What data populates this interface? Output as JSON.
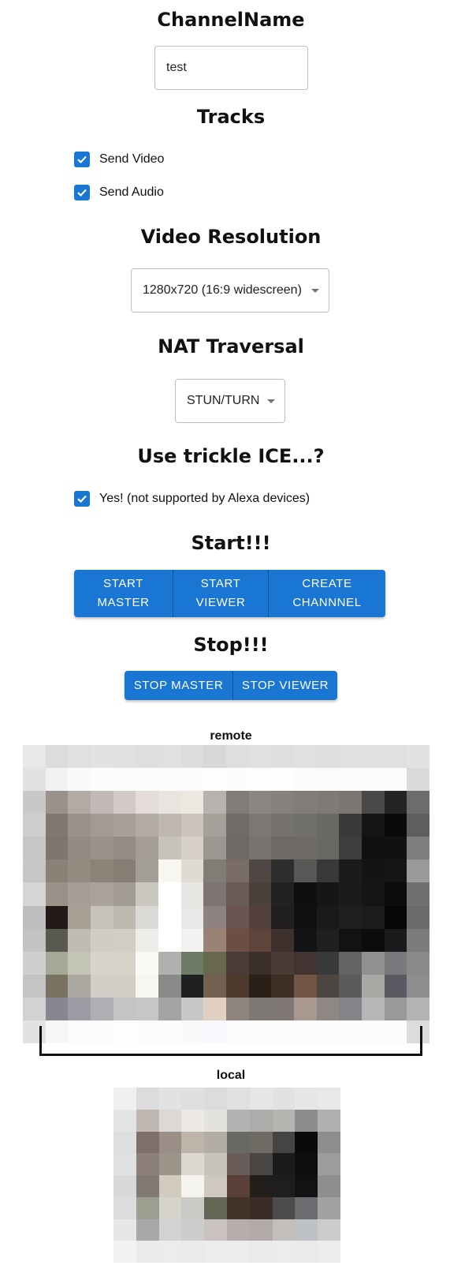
{
  "channel": {
    "heading": "ChannelName",
    "value": "test"
  },
  "tracks": {
    "heading": "Tracks",
    "send_video_label": "Send Video",
    "send_audio_label": "Send Audio"
  },
  "resolution": {
    "heading": "Video Resolution",
    "selected": "1280x720 (16:9 widescreen)"
  },
  "nat": {
    "heading": "NAT Traversal",
    "selected": "STUN/TURN"
  },
  "trickle": {
    "heading": "Use trickle ICE...?",
    "label": "Yes! (not supported by Alexa devices)"
  },
  "start": {
    "heading": "Start!!!",
    "master_label": "START\nMASTER",
    "viewer_label": "START\nVIEWER",
    "create_channel_label": "CREATE\nCHANNNEL"
  },
  "stop": {
    "heading": "Stop!!!",
    "master_label": "STOP MASTER",
    "viewer_label": "STOP VIEWER"
  },
  "remote_video": {
    "label": "remote"
  },
  "local_video": {
    "label": "local"
  },
  "colors": {
    "accent": "#1976d2",
    "checkbox": "#1976d2"
  }
}
